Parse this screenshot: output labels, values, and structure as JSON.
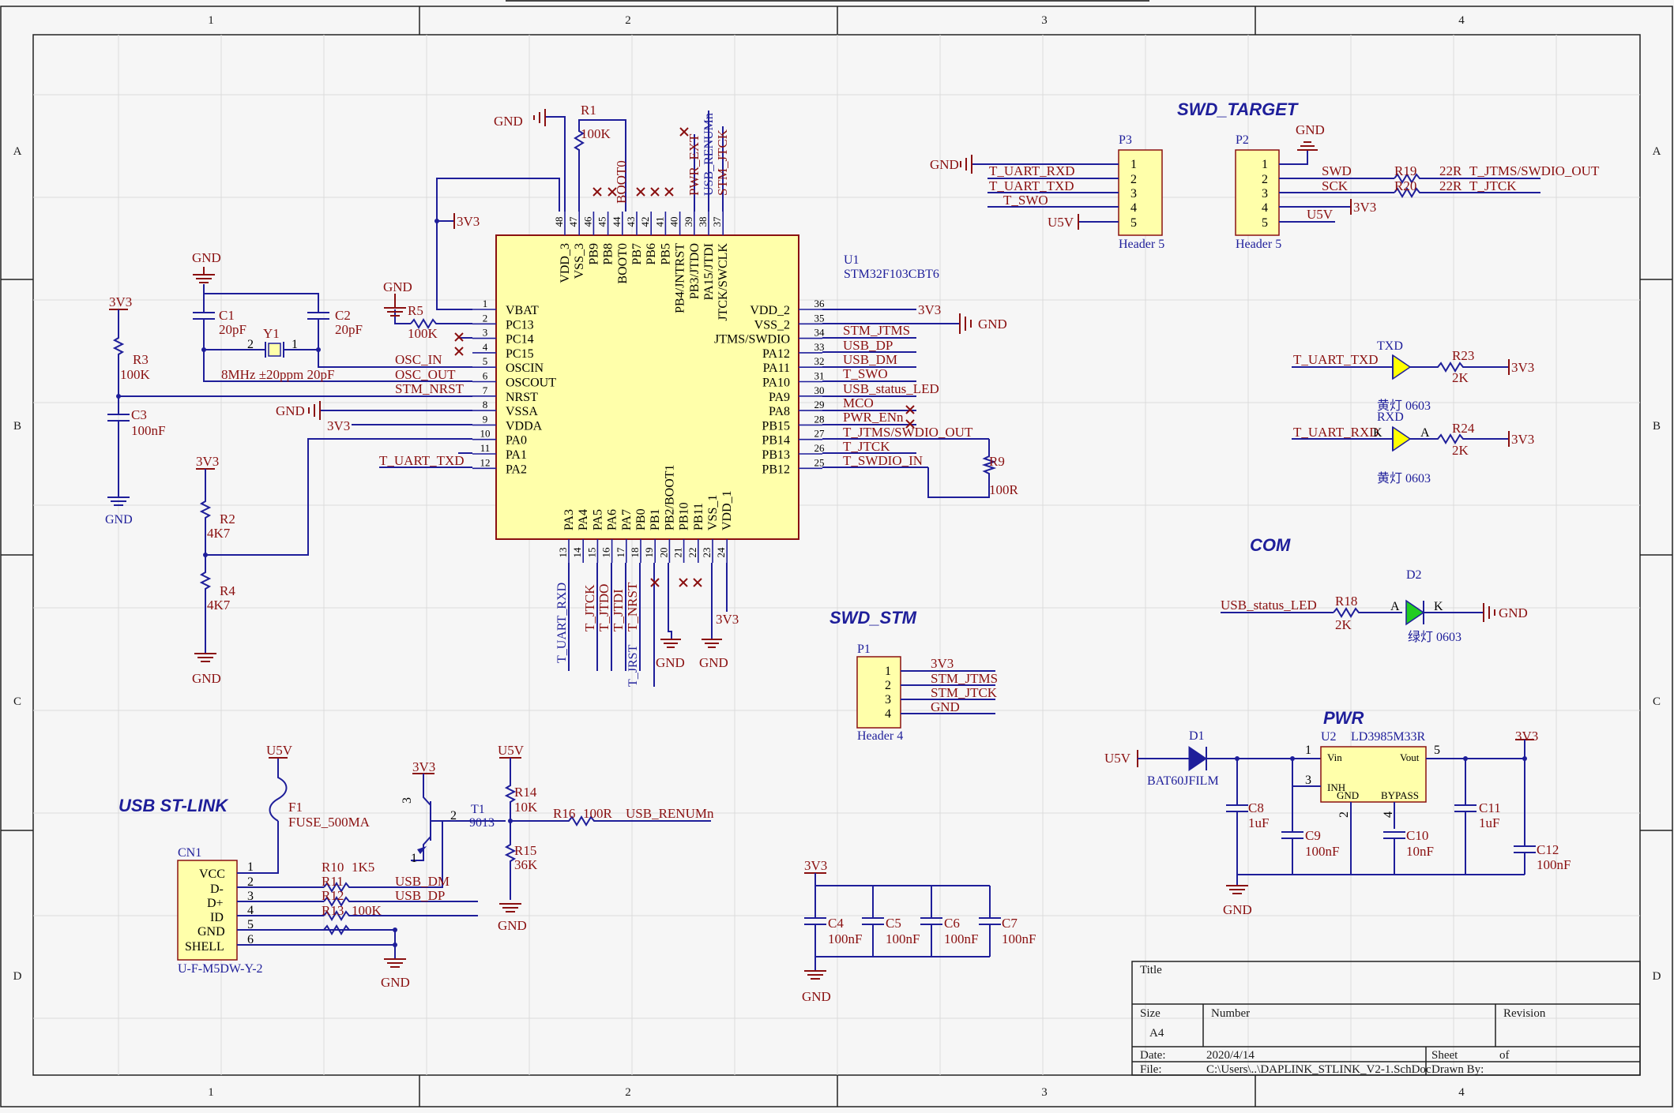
{
  "sheet": {
    "columns": [
      "1",
      "2",
      "3",
      "4"
    ],
    "rows": [
      "A",
      "B",
      "C",
      "D"
    ]
  },
  "sections": {
    "swd_target": "SWD_TARGET",
    "com": "COM",
    "swd_stm": "SWD_STM",
    "pwr": "PWR",
    "usb": "USB ST-LINK"
  },
  "u1": {
    "ref": "U1",
    "part": "STM32F103CBT6",
    "left_pins": [
      {
        "num": "1",
        "name": "VBAT"
      },
      {
        "num": "2",
        "name": "PC13"
      },
      {
        "num": "3",
        "name": "PC14"
      },
      {
        "num": "4",
        "name": "PC15"
      },
      {
        "num": "5",
        "name": "OSCIN"
      },
      {
        "num": "6",
        "name": "OSCOUT"
      },
      {
        "num": "7",
        "name": "NRST"
      },
      {
        "num": "8",
        "name": "VSSA"
      },
      {
        "num": "9",
        "name": "VDDA"
      },
      {
        "num": "10",
        "name": "PA0"
      },
      {
        "num": "11",
        "name": "PA1"
      },
      {
        "num": "12",
        "name": "PA2"
      }
    ],
    "right_pins": [
      {
        "num": "36",
        "name": "VDD_2"
      },
      {
        "num": "35",
        "name": "VSS_2"
      },
      {
        "num": "34",
        "name": "JTMS/SWDIO"
      },
      {
        "num": "33",
        "name": "PA12"
      },
      {
        "num": "32",
        "name": "PA11"
      },
      {
        "num": "31",
        "name": "PA10"
      },
      {
        "num": "30",
        "name": "PA9"
      },
      {
        "num": "29",
        "name": "PA8"
      },
      {
        "num": "28",
        "name": "PB15"
      },
      {
        "num": "27",
        "name": "PB14"
      },
      {
        "num": "26",
        "name": "PB13"
      },
      {
        "num": "25",
        "name": "PB12"
      }
    ],
    "top_pins": [
      {
        "num": "48",
        "name": "VDD_3"
      },
      {
        "num": "47",
        "name": "VSS_3"
      },
      {
        "num": "46",
        "name": "PB9"
      },
      {
        "num": "45",
        "name": "PB8"
      },
      {
        "num": "44",
        "name": "BOOT0"
      },
      {
        "num": "43",
        "name": "PB7"
      },
      {
        "num": "42",
        "name": "PB6"
      },
      {
        "num": "41",
        "name": "PB5"
      },
      {
        "num": "40",
        "name": "PB4/JNTRST"
      },
      {
        "num": "39",
        "name": "PB3/JTDO"
      },
      {
        "num": "38",
        "name": "PA15/JTDI"
      },
      {
        "num": "37",
        "name": "JTCK/SWCLK"
      }
    ],
    "bottom_pins": [
      {
        "num": "13",
        "name": "PA3"
      },
      {
        "num": "14",
        "name": "PA4"
      },
      {
        "num": "15",
        "name": "PA5"
      },
      {
        "num": "16",
        "name": "PA6"
      },
      {
        "num": "17",
        "name": "PA7"
      },
      {
        "num": "18",
        "name": "PB0"
      },
      {
        "num": "19",
        "name": "PB1"
      },
      {
        "num": "20",
        "name": "PB2/BOOT1"
      },
      {
        "num": "21",
        "name": "PB10"
      },
      {
        "num": "22",
        "name": "PB11"
      },
      {
        "num": "23",
        "name": "VSS_1"
      },
      {
        "num": "24",
        "name": "VDD_1"
      }
    ],
    "right_nets": [
      "3V3",
      "GND",
      "STM_JTMS",
      "USB_DP",
      "USB_DM",
      "T_SWO",
      "USB_status_LED",
      "MCO",
      "PWR_ENn",
      "T_JTMS/SWDIO_OUT",
      "T_JTCK",
      "T_SWDIO_IN"
    ],
    "top_nets": [
      "BOOT0",
      "PWR_EXT",
      "USB_RENUMn",
      "STM_JTCK"
    ],
    "bottom_nets": [
      "T_UART_RXD",
      "T_JTCK",
      "T_JTDO",
      "T_JTDI",
      "T_NRST",
      "T_JRST"
    ],
    "left_nets": [
      "OSC_IN",
      "OSC_OUT",
      "STM_NRST",
      "GND",
      "3V3",
      "T_UART_TXD"
    ]
  },
  "power_labels": {
    "v33": "3V3",
    "gnd": "GND",
    "u5v": "U5V"
  },
  "passives": {
    "r1": {
      "ref": "R1",
      "val": "100K"
    },
    "r5": {
      "ref": "R5",
      "val": "100K"
    },
    "r3": {
      "ref": "R3",
      "val": "100K"
    },
    "c3": {
      "ref": "C3",
      "val": "100nF"
    },
    "c1": {
      "ref": "C1",
      "val": "20pF"
    },
    "c2": {
      "ref": "C2",
      "val": "20pF"
    },
    "y1": {
      "ref": "Y1",
      "val": "8MHz ±20ppm 20pF"
    },
    "r2": {
      "ref": "R2",
      "val": "4K7"
    },
    "r4": {
      "ref": "R4",
      "val": "4K7"
    },
    "r9": {
      "ref": "R9",
      "val": "100R"
    },
    "r19": {
      "ref": "R19",
      "val": "22R"
    },
    "r20": {
      "ref": "R20",
      "val": "22R"
    },
    "r23": {
      "ref": "R23",
      "val": "2K"
    },
    "r24": {
      "ref": "R24",
      "val": "2K"
    },
    "r18": {
      "ref": "R18",
      "val": "2K"
    },
    "r10": {
      "ref": "R10",
      "val": "1K5"
    },
    "r11": {
      "ref": "R11",
      "val": ""
    },
    "r12": {
      "ref": "R12",
      "val": ""
    },
    "r13": {
      "ref": "R13",
      "val": "100K"
    },
    "r14": {
      "ref": "R14",
      "val": "10K"
    },
    "r15": {
      "ref": "R15",
      "val": "36K"
    },
    "r16": {
      "ref": "R16",
      "val": "100R"
    },
    "f1": {
      "ref": "F1",
      "val": "FUSE_500MA"
    },
    "t1": {
      "ref": "T1",
      "val": "9013"
    },
    "c4": {
      "ref": "C4",
      "val": "100nF"
    },
    "c5": {
      "ref": "C5",
      "val": "100nF"
    },
    "c6": {
      "ref": "C6",
      "val": "100nF"
    },
    "c7": {
      "ref": "C7",
      "val": "100nF"
    },
    "c8": {
      "ref": "C8",
      "val": "1uF"
    },
    "c9": {
      "ref": "C9",
      "val": "100nF"
    },
    "c10": {
      "ref": "C10",
      "val": "10nF"
    },
    "c11": {
      "ref": "C11",
      "val": "1uF"
    },
    "c12": {
      "ref": "C12",
      "val": "100nF"
    },
    "d1": {
      "ref": "D1",
      "val": "BAT60JFILM"
    },
    "d2": {
      "ref": "D2",
      "val": "绿灯 0603"
    }
  },
  "p3": {
    "ref": "P3",
    "name": "Header 5",
    "pins": [
      "1",
      "2",
      "3",
      "4",
      "5"
    ],
    "nets": [
      "T_UART_RXD",
      "T_UART_TXD",
      "T_SWO"
    ]
  },
  "p2": {
    "ref": "P2",
    "name": "Header 5",
    "pins": [
      "1",
      "2",
      "3",
      "4",
      "5"
    ],
    "nets": [
      "SWD",
      "SCK",
      "U5V"
    ],
    "out": [
      "T_JTMS/SWDIO_OUT",
      "T_JTCK"
    ]
  },
  "p1": {
    "ref": "P1",
    "name": "Header 4",
    "pins": [
      "1",
      "2",
      "3",
      "4"
    ],
    "nets": [
      "3V3",
      "STM_JTMS",
      "STM_JTCK",
      "GND"
    ]
  },
  "leds": {
    "txd": {
      "label": "TXD",
      "net": "T_UART_TXD",
      "part": "黄灯 0603"
    },
    "rxd": {
      "label": "RXD",
      "net": "T_UART_RXD",
      "part": "黄灯 0603"
    },
    "k": "K",
    "a": "A",
    "status_net": "USB_status_LED"
  },
  "u2": {
    "ref": "U2",
    "part": "LD3985M33R",
    "vin": "Vin",
    "vout": "Vout",
    "inh": "INH",
    "gnd": "GND",
    "bypass": "BYPASS",
    "p1": "1",
    "p2": "2",
    "p3": "3",
    "p4": "4",
    "p5": "5"
  },
  "cn1": {
    "ref": "CN1",
    "part": "U-F-M5DW-Y-2",
    "pins": [
      "VCC",
      "D-",
      "D+",
      "ID",
      "GND",
      "SHELL"
    ],
    "nums": [
      "1",
      "2",
      "3",
      "4",
      "5",
      "6"
    ]
  },
  "usb_nets": {
    "dm": "USB_DM",
    "dp": "USB_DP",
    "renum": "USB_RENUMn"
  },
  "titleblock": {
    "title": "Title",
    "size": "Size",
    "size_val": "A4",
    "number": "Number",
    "revision": "Revision",
    "date_label": "Date:",
    "date": "2020/4/14",
    "file_label": "File:",
    "file": "C:\\Users\\..\\DAPLINK_STLINK_V2-1.SchDoc",
    "sheet": "Sheet",
    "of": "of",
    "drawn_by": "Drawn By:"
  }
}
